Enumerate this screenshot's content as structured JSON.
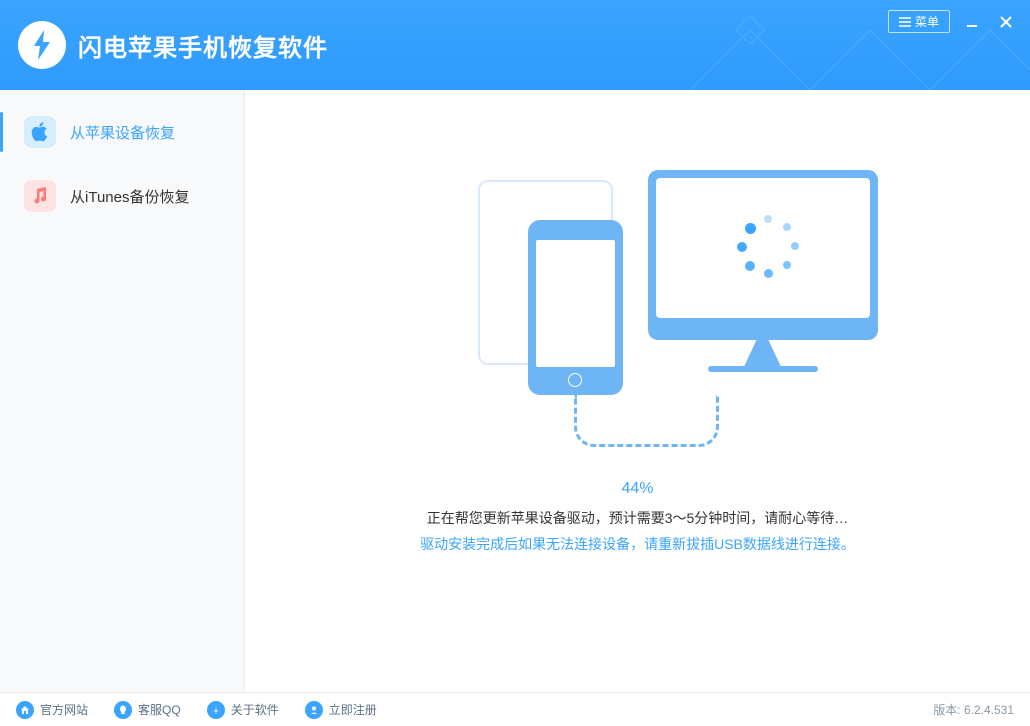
{
  "header": {
    "app_title": "闪电苹果手机恢复软件",
    "menu_label": "菜单"
  },
  "sidebar": {
    "items": [
      {
        "label": "从苹果设备恢复",
        "active": true
      },
      {
        "label": "从iTunes备份恢复",
        "active": false
      }
    ]
  },
  "main": {
    "progress_pct": "44%",
    "status_line1": "正在帮您更新苹果设备驱动，预计需要3～5分钟时间，请耐心等待…",
    "status_line2": "驱动安装完成后如果无法连接设备，请重新拔插USB数据线进行连接。"
  },
  "footer": {
    "links": [
      {
        "label": "官方网站"
      },
      {
        "label": "客服QQ"
      },
      {
        "label": "关于软件"
      },
      {
        "label": "立即注册"
      }
    ],
    "version_label": "版本: 6.2.4.531"
  }
}
